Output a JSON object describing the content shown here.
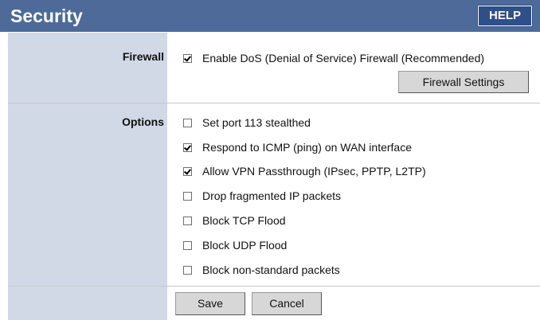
{
  "header": {
    "title": "Security",
    "help_label": "HELP"
  },
  "firewall": {
    "label": "Firewall",
    "enable_dos_label": "Enable DoS (Denial of Service) Firewall (Recommended)",
    "enable_dos_checked": true,
    "settings_button_label": "Firewall Settings"
  },
  "options": {
    "label": "Options",
    "items": [
      {
        "label": "Set port 113 stealthed",
        "checked": false
      },
      {
        "label": "Respond to ICMP (ping) on WAN interface",
        "checked": true
      },
      {
        "label": "Allow VPN Passthrough (IPsec, PPTP, L2TP)",
        "checked": true
      },
      {
        "label": "Drop fragmented IP packets",
        "checked": false
      },
      {
        "label": "Block TCP Flood",
        "checked": false
      },
      {
        "label": "Block UDP Flood",
        "checked": false
      },
      {
        "label": "Block non-standard packets",
        "checked": false
      }
    ]
  },
  "footer": {
    "save_label": "Save",
    "cancel_label": "Cancel"
  },
  "colors": {
    "header_bg": "#4d6a99",
    "help_bg": "#2e4f88",
    "label_col_bg": "#d1d8e6",
    "button_bg": "#d7d7d7"
  }
}
